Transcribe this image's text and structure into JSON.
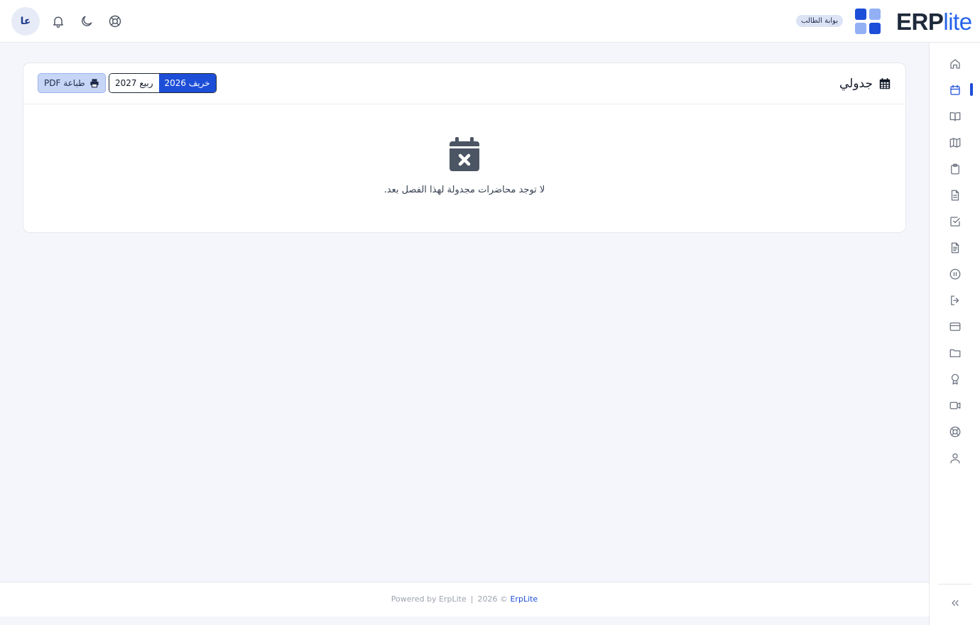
{
  "header": {
    "avatar_initials": "عا",
    "portal_badge": "بوابة الطالب",
    "logo": {
      "part_bold": "ERP",
      "part_light": "lite"
    },
    "icons": [
      "support-icon",
      "moon-icon",
      "bell-icon"
    ]
  },
  "sidebar": {
    "items": [
      {
        "icon": "home-icon"
      },
      {
        "icon": "calendar-icon",
        "active": true
      },
      {
        "icon": "book-icon"
      },
      {
        "icon": "map-icon"
      },
      {
        "icon": "clipboard-icon"
      },
      {
        "icon": "document-icon"
      },
      {
        "icon": "checkbox-icon"
      },
      {
        "icon": "file-text-icon"
      },
      {
        "icon": "pause-circle-icon"
      },
      {
        "icon": "logout-icon"
      },
      {
        "icon": "credit-card-icon"
      },
      {
        "icon": "folder-icon"
      },
      {
        "icon": "award-icon"
      },
      {
        "icon": "video-icon"
      },
      {
        "icon": "lifebuoy-icon"
      },
      {
        "icon": "user-icon"
      }
    ],
    "collapse_icon": "chevrons-left-icon"
  },
  "schedule": {
    "title": "جدولي",
    "terms": [
      {
        "label": "خريف 2026",
        "selected": true
      },
      {
        "label": "ربيع 2027",
        "selected": false
      }
    ],
    "print_label": "طباعة PDF",
    "empty_message": "لا توجد محاضرات مجدولة لهذا الفصل بعد."
  },
  "footer": {
    "copyright_year": "2026 ©",
    "brand_link": "ErpLite",
    "separator": "|",
    "powered_by": "Powered by ErpLite"
  },
  "colors": {
    "accent": "#1d4ed8",
    "accent_light": "#93b0f5",
    "background": "#f4f6fb"
  }
}
